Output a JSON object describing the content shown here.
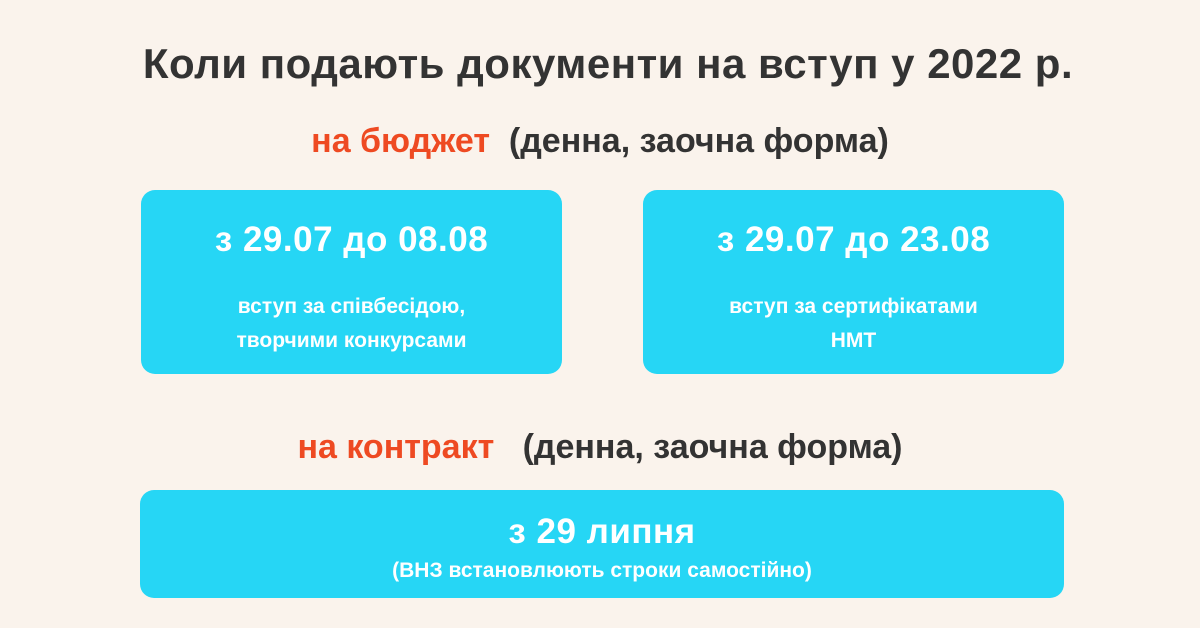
{
  "title": "Коли подають документи на вступ у 2022 р.",
  "budget": {
    "label": "на бюджет",
    "form": "(денна, заочна форма)",
    "cards": [
      {
        "dates": "з 29.07 до 08.08",
        "line1": "вступ за співбесідою,",
        "line2": "творчими конкурсами"
      },
      {
        "dates": "з 29.07 до 23.08",
        "line1": "вступ за сертифікатами",
        "line2": "НМТ"
      }
    ]
  },
  "contract": {
    "label": "на контракт",
    "form": "(денна, заочна форма)",
    "card": {
      "dates": "з 29 липня",
      "note": "(ВНЗ встановлюють строки самостійно)"
    }
  },
  "colors": {
    "background": "#faf3ec",
    "accent": "#ee4a22",
    "card": "#26d6f5",
    "text": "#333333"
  }
}
